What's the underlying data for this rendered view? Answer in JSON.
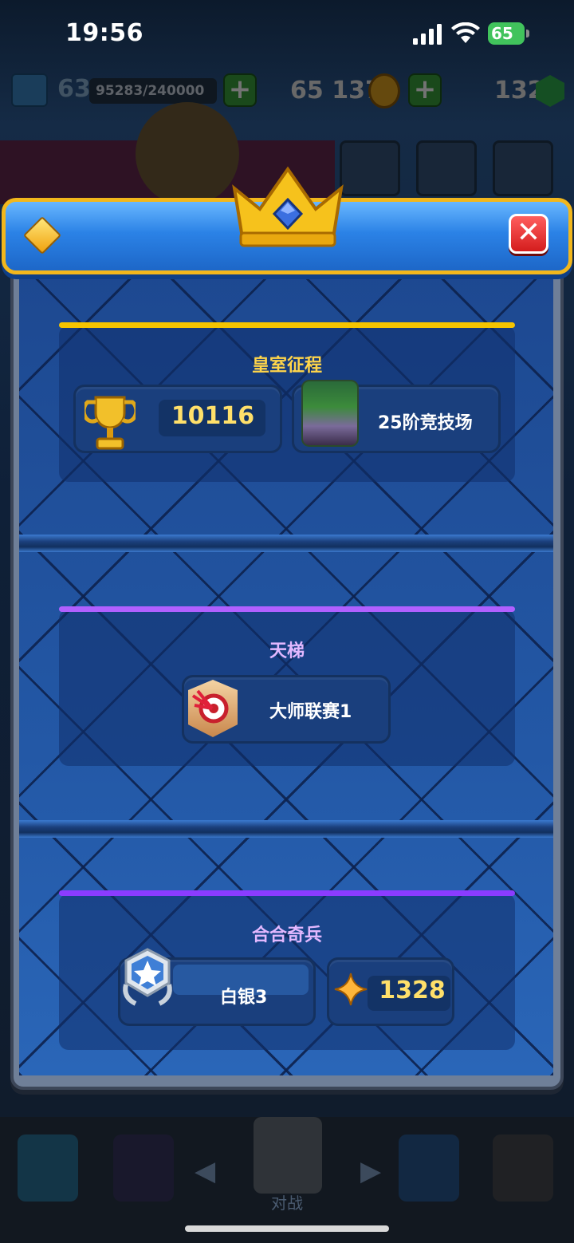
{
  "status_bar": {
    "time": "19:56",
    "battery": "65"
  },
  "hud": {
    "level": "63",
    "xp": "95283/240000",
    "gold": "65 137",
    "gems": "132",
    "plus": "+"
  },
  "modal": {
    "close_icon": "✕",
    "crown_icon": "crown-with-sapphire",
    "colors": {
      "header_blue": "#2b82e6",
      "header_border": "#f2b71c",
      "royal_accent": "#f5c400",
      "ladder_accent": "#b060ff",
      "merge_accent": "#8b3cff"
    },
    "sections": {
      "royal_path": {
        "title": "皇室征程",
        "trophies": "10116",
        "arena": "25阶竞技场"
      },
      "ladder": {
        "title": "天梯",
        "league": "大师联赛1"
      },
      "merge_tactics": {
        "title": "合合奇兵",
        "rank": "白银3",
        "points": "1328"
      }
    }
  },
  "bottom_nav": {
    "battle_label": "对战",
    "left_chevron": "◀",
    "right_chevron": "▶"
  }
}
